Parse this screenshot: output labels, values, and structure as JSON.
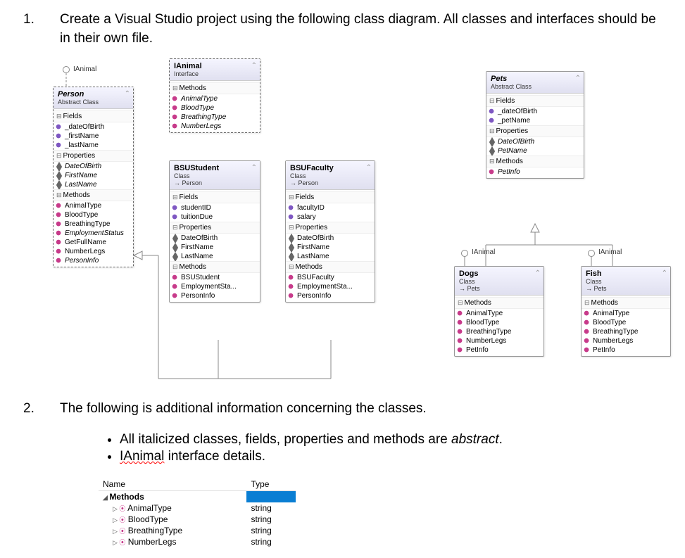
{
  "q1": {
    "num": "1.",
    "text": "Create a Visual Studio project using the following class diagram. All classes and interfaces should be in their own file."
  },
  "ianimal_label_person": "IAnimal",
  "ianimal_label_dogs": "IAnimal",
  "ianimal_label_fish": "IAnimal",
  "boxes": {
    "person": {
      "title": "Person",
      "subtitle": "Abstract Class",
      "sections": [
        {
          "h": "Fields",
          "items": [
            {
              "t": "_dateOfBirth",
              "k": "field"
            },
            {
              "t": "_firstName",
              "k": "field"
            },
            {
              "t": "_lastName",
              "k": "field"
            }
          ]
        },
        {
          "h": "Properties",
          "items": [
            {
              "t": "DateOfBirth",
              "k": "prop",
              "i": true
            },
            {
              "t": "FirstName",
              "k": "prop",
              "i": true
            },
            {
              "t": "LastName",
              "k": "prop",
              "i": true
            }
          ]
        },
        {
          "h": "Methods",
          "items": [
            {
              "t": "AnimalType",
              "k": "method"
            },
            {
              "t": "BloodType",
              "k": "method"
            },
            {
              "t": "BreathingType",
              "k": "method"
            },
            {
              "t": "EmploymentStatus",
              "k": "method",
              "i": true
            },
            {
              "t": "GetFullName",
              "k": "method"
            },
            {
              "t": "NumberLegs",
              "k": "method"
            },
            {
              "t": "PersonInfo",
              "k": "method",
              "i": true
            }
          ]
        }
      ]
    },
    "ianimal": {
      "title": "IAnimal",
      "subtitle": "Interface",
      "sections": [
        {
          "h": "Methods",
          "items": [
            {
              "t": "AnimalType",
              "k": "method",
              "i": true
            },
            {
              "t": "BloodType",
              "k": "method",
              "i": true
            },
            {
              "t": "BreathingType",
              "k": "method",
              "i": true
            },
            {
              "t": "NumberLegs",
              "k": "method",
              "i": true
            }
          ]
        }
      ]
    },
    "bsustudent": {
      "title": "BSUStudent",
      "subtitle": "Class",
      "inherit": "→ Person",
      "sections": [
        {
          "h": "Fields",
          "items": [
            {
              "t": "studentID",
              "k": "field"
            },
            {
              "t": "tuitionDue",
              "k": "field"
            }
          ]
        },
        {
          "h": "Properties",
          "items": [
            {
              "t": "DateOfBirth",
              "k": "prop"
            },
            {
              "t": "FirstName",
              "k": "prop"
            },
            {
              "t": "LastName",
              "k": "prop"
            }
          ]
        },
        {
          "h": "Methods",
          "items": [
            {
              "t": "BSUStudent",
              "k": "method"
            },
            {
              "t": "EmploymentSta...",
              "k": "method"
            },
            {
              "t": "PersonInfo",
              "k": "method"
            }
          ]
        }
      ]
    },
    "bsufaculty": {
      "title": "BSUFaculty",
      "subtitle": "Class",
      "inherit": "→ Person",
      "sections": [
        {
          "h": "Fields",
          "items": [
            {
              "t": "facultyID",
              "k": "field"
            },
            {
              "t": "salary",
              "k": "field"
            }
          ]
        },
        {
          "h": "Properties",
          "items": [
            {
              "t": "DateOfBirth",
              "k": "prop"
            },
            {
              "t": "FirstName",
              "k": "prop"
            },
            {
              "t": "LastName",
              "k": "prop"
            }
          ]
        },
        {
          "h": "Methods",
          "items": [
            {
              "t": "BSUFaculty",
              "k": "method"
            },
            {
              "t": "EmploymentSta...",
              "k": "method"
            },
            {
              "t": "PersonInfo",
              "k": "method"
            }
          ]
        }
      ]
    },
    "pets": {
      "title": "Pets",
      "subtitle": "Abstract Class",
      "sections": [
        {
          "h": "Fields",
          "items": [
            {
              "t": "_dateOfBirth",
              "k": "field"
            },
            {
              "t": "_petName",
              "k": "field"
            }
          ]
        },
        {
          "h": "Properties",
          "items": [
            {
              "t": "DateOfBirth",
              "k": "prop",
              "i": true
            },
            {
              "t": "PetName",
              "k": "prop",
              "i": true
            }
          ]
        },
        {
          "h": "Methods",
          "items": [
            {
              "t": "PetInfo",
              "k": "method",
              "i": true
            }
          ]
        }
      ]
    },
    "dogs": {
      "title": "Dogs",
      "subtitle": "Class",
      "inherit": "→ Pets",
      "sections": [
        {
          "h": "Methods",
          "items": [
            {
              "t": "AnimalType",
              "k": "method"
            },
            {
              "t": "BloodType",
              "k": "method"
            },
            {
              "t": "BreathingType",
              "k": "method"
            },
            {
              "t": "NumberLegs",
              "k": "method"
            },
            {
              "t": "PetInfo",
              "k": "method"
            }
          ]
        }
      ]
    },
    "fish": {
      "title": "Fish",
      "subtitle": "Class",
      "inherit": "→ Pets",
      "sections": [
        {
          "h": "Methods",
          "items": [
            {
              "t": "AnimalType",
              "k": "method"
            },
            {
              "t": "BloodType",
              "k": "method"
            },
            {
              "t": "BreathingType",
              "k": "method"
            },
            {
              "t": "NumberLegs",
              "k": "method"
            },
            {
              "t": "PetInfo",
              "k": "method"
            }
          ]
        }
      ]
    }
  },
  "q2": {
    "num": "2.",
    "text": "The following is additional information concerning the classes.",
    "b1_a": "All italicized classes, fields, properties and methods are ",
    "b1_b": "abstract",
    "b1_c": ".",
    "b2_a": "IAnimal",
    "b2_b": " interface details.",
    "thead": {
      "c1": "Name",
      "c2": "Type"
    },
    "methods_label": "Methods",
    "rows": [
      {
        "n": "AnimalType",
        "t": "string"
      },
      {
        "n": "BloodType",
        "t": "string"
      },
      {
        "n": "BreathingType",
        "t": "string"
      },
      {
        "n": "NumberLegs",
        "t": "string"
      }
    ]
  }
}
